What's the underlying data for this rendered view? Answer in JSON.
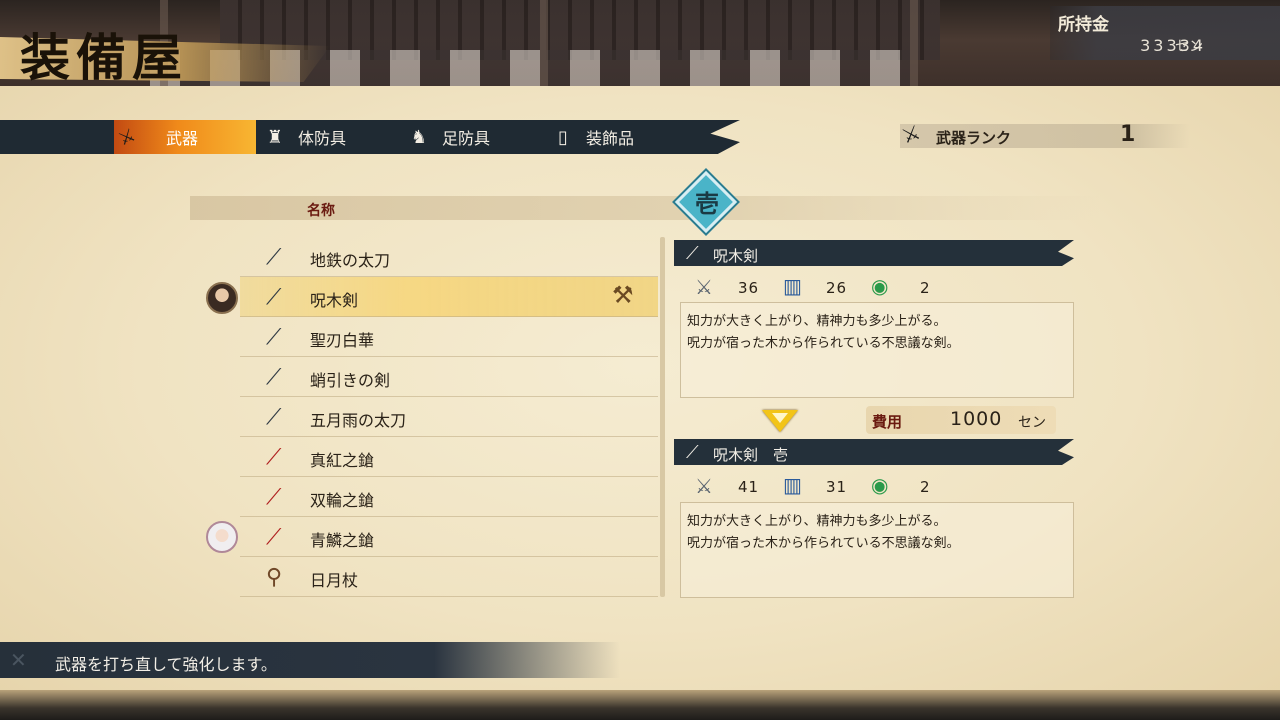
{
  "header": {
    "title": "装備屋",
    "money_label": "所持金",
    "money_value": "33334",
    "money_unit": "セン"
  },
  "tabs": [
    {
      "label": "武器",
      "icon": "katana-icon",
      "active": true
    },
    {
      "label": "体防具",
      "icon": "body-armor-icon",
      "active": false
    },
    {
      "label": "足防具",
      "icon": "boots-icon",
      "active": false
    },
    {
      "label": "装飾品",
      "icon": "ornament-icon",
      "active": false
    }
  ],
  "rank": {
    "label": "武器ランク",
    "value": "1"
  },
  "list": {
    "header": "名称",
    "tier_badge": "壱",
    "items": [
      {
        "label": "地鉄の太刀",
        "icon": "sword-icon",
        "type": "blade"
      },
      {
        "label": "呪木剣",
        "icon": "sword-icon",
        "type": "blade",
        "selected": true
      },
      {
        "label": "聖刃白華",
        "icon": "sword-icon",
        "type": "blade"
      },
      {
        "label": "蛸引きの剣",
        "icon": "sword-icon",
        "type": "blade"
      },
      {
        "label": "五月雨の太刀",
        "icon": "sword-icon",
        "type": "blade"
      },
      {
        "label": "真紅之鎗",
        "icon": "spear-icon",
        "type": "spear"
      },
      {
        "label": "双輪之鎗",
        "icon": "spear-icon",
        "type": "spear"
      },
      {
        "label": "青鱗之鎗",
        "icon": "spear-icon",
        "type": "spear"
      },
      {
        "label": "日月杖",
        "icon": "staff-icon",
        "type": "staff"
      }
    ]
  },
  "current": {
    "name": "呪木剣",
    "attack": "36",
    "spirit": "26",
    "slots": "2",
    "desc1": "知力が大きく上がり、精神力も多少上がる。",
    "desc2": "呪力が宿った木から作られている不思議な剣。"
  },
  "cost": {
    "label": "費用",
    "value": "1000",
    "unit": "セン"
  },
  "upgraded": {
    "name": "呪木剣　壱",
    "attack": "41",
    "spirit": "31",
    "slots": "2",
    "desc1": "知力が大きく上がり、精神力も多少上がる。",
    "desc2": "呪力が宿った木から作られている不思議な剣。"
  },
  "help": {
    "text": "武器を打ち直して強化します。"
  },
  "colors": {
    "accent_orange": "#f08a1a",
    "dark_navy": "#1f2a33",
    "parchment": "#f0e3c2",
    "label_red": "#6a1a10",
    "arrow_yellow": "#f2c418"
  }
}
